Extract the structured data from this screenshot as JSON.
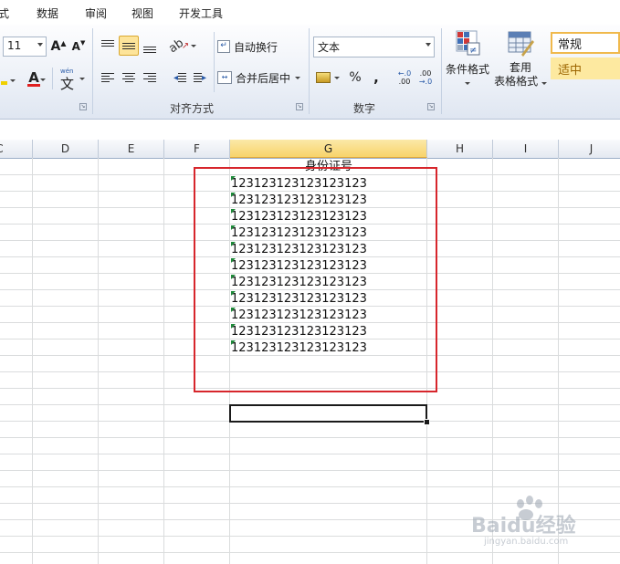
{
  "menu": {
    "items": [
      "式",
      "数据",
      "审阅",
      "视图",
      "开发工具"
    ]
  },
  "ribbon": {
    "font": {
      "size_value": "11",
      "grow_label": "A",
      "shrink_label": "A",
      "font_color_label": "A",
      "phonetic_label": "文"
    },
    "alignment": {
      "wrap_text_label": "自动换行",
      "merge_center_label": "合并后居中",
      "group_label": "对齐方式"
    },
    "number": {
      "format_value": "文本",
      "percent_label": "%",
      "comma_label": ",",
      "inc_decimal_label": ".00",
      "dec_decimal_label": ".00",
      "group_label": "数字"
    },
    "styles": {
      "conditional_format_label": "条件格式",
      "format_as_table_line1": "套用",
      "format_as_table_line2": "表格格式",
      "style_normal": "常规",
      "style_neutral": "适中"
    }
  },
  "sheet": {
    "columns": [
      "C",
      "D",
      "E",
      "F",
      "G",
      "H",
      "I",
      "J"
    ],
    "selected_column": "G",
    "header_cell": "身份证号",
    "values": [
      "123123123123123123",
      "123123123123123123",
      "123123123123123123",
      "123123123123123123",
      "123123123123123123",
      "123123123123123123",
      "123123123123123123",
      "123123123123123123",
      "123123123123123123",
      "123123123123123123",
      "123123123123123123"
    ]
  },
  "watermark": {
    "brand": "Baidu经验",
    "url": "jingyan.baidu.com"
  },
  "colors": {
    "highlight_box": "#d7262c",
    "selected_column_header": "#f8d36a",
    "neutral_style": "#fde9a0",
    "error_triangle": "#1e8a3a"
  }
}
